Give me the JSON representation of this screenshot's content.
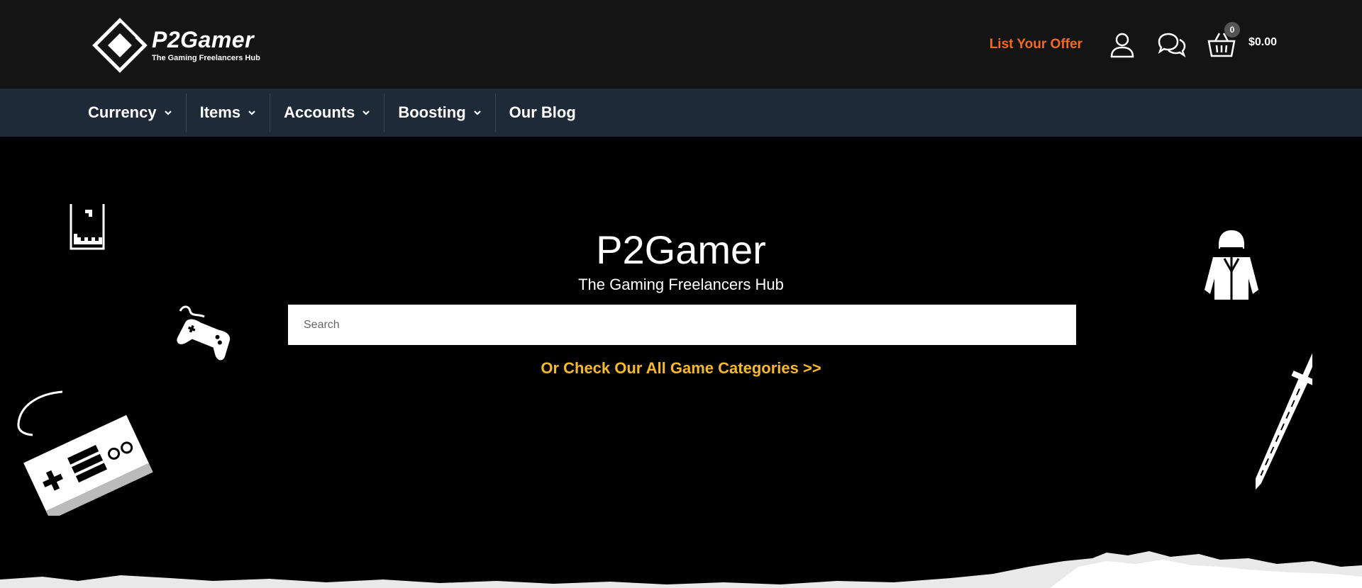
{
  "header": {
    "logo_name": "P2Gamer",
    "logo_tagline": "The Gaming Freelancers Hub",
    "list_offer_label": "List Your Offer",
    "cart_count": "0",
    "cart_total": "$0.00",
    "accent_color": "#f26a21"
  },
  "nav": {
    "items": [
      {
        "label": "Currency",
        "has_dropdown": true
      },
      {
        "label": "Items",
        "has_dropdown": true
      },
      {
        "label": "Accounts",
        "has_dropdown": true
      },
      {
        "label": "Boosting",
        "has_dropdown": true
      },
      {
        "label": "Our Blog",
        "has_dropdown": false
      }
    ]
  },
  "hero": {
    "title": "P2Gamer",
    "subtitle": "The Gaming Freelancers Hub",
    "search_placeholder": "Search",
    "search_value": "",
    "categories_link": "Or Check Our All Game Categories >>",
    "link_color": "#f6b92b"
  },
  "icons": [
    "logo-diamond-icon",
    "user-icon",
    "chat-icon",
    "cart-basket-icon",
    "chevron-down-icon",
    "tetris-icon",
    "gamepad-icon",
    "nes-controller-icon",
    "pubg-character-icon",
    "sword-icon"
  ]
}
